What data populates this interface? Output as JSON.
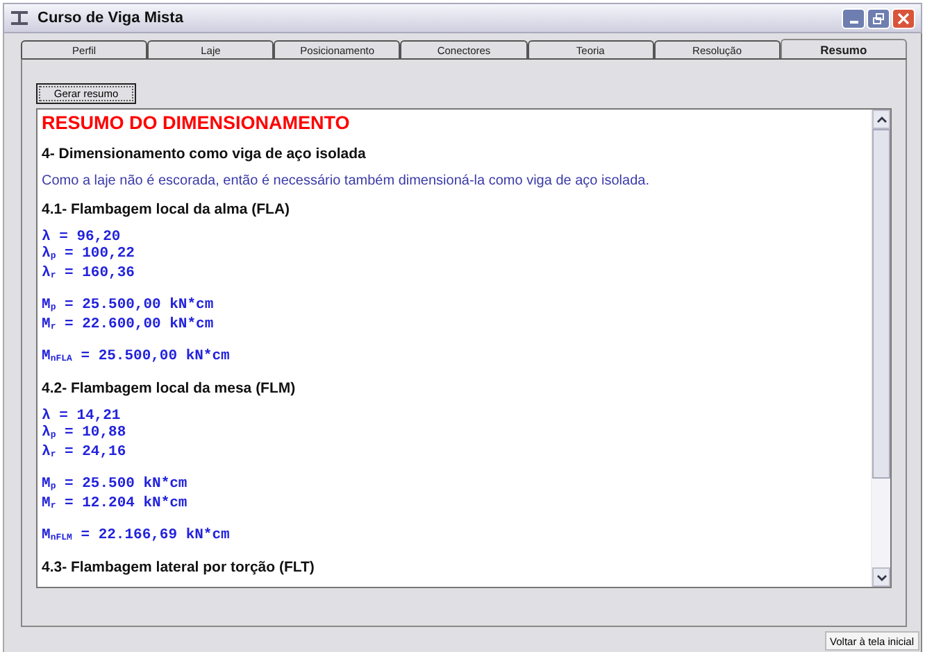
{
  "window": {
    "title": "Curso de Viga Mista"
  },
  "tabs": [
    {
      "label": "Perfil",
      "selected": false
    },
    {
      "label": "Laje",
      "selected": false
    },
    {
      "label": "Posicionamento",
      "selected": false
    },
    {
      "label": "Conectores",
      "selected": false
    },
    {
      "label": "Teoria",
      "selected": false
    },
    {
      "label": "Resolução",
      "selected": false
    },
    {
      "label": "Resumo",
      "selected": true
    }
  ],
  "generate_button": "Gerar resumo",
  "report": [
    {
      "kind": "title",
      "text": "RESUMO DO DIMENSIONAMENTO"
    },
    {
      "kind": "heading",
      "text": "4- Dimensionamento como viga de aço isolada"
    },
    {
      "kind": "paragraph",
      "text": "Como a laje não é escorada, então é necessário também dimensioná-la como viga de aço isolada."
    },
    {
      "kind": "heading",
      "text": "4.1- Flambagem local da alma (FLA)"
    },
    {
      "kind": "values",
      "lines": [
        "λ = 96,20",
        "λ$_{p}$ = 100,22",
        "λ$_{r}$ = 160,36"
      ]
    },
    {
      "kind": "values",
      "lines": [
        "M$_{p}$ = 25.500,00 kN*cm",
        "M$_{r}$ = 22.600,00 kN*cm"
      ]
    },
    {
      "kind": "values",
      "lines": [
        "M$_{nFLA}$ = 25.500,00 kN*cm"
      ]
    },
    {
      "kind": "heading",
      "text": "4.2- Flambagem local da mesa (FLM)"
    },
    {
      "kind": "values",
      "lines": [
        "λ = 14,21",
        "λ$_{p}$ = 10,88",
        "λ$_{r}$ = 24,16"
      ]
    },
    {
      "kind": "values",
      "lines": [
        "M$_{p}$ = 25.500 kN*cm",
        "M$_{r}$ = 12.204 kN*cm"
      ]
    },
    {
      "kind": "values",
      "lines": [
        "M$_{nFLM}$ = 22.166,69 kN*cm"
      ]
    },
    {
      "kind": "heading",
      "text": "4.3- Flambagem lateral por torção (FLT)"
    }
  ],
  "back_button": "Voltar à tela inicial"
}
